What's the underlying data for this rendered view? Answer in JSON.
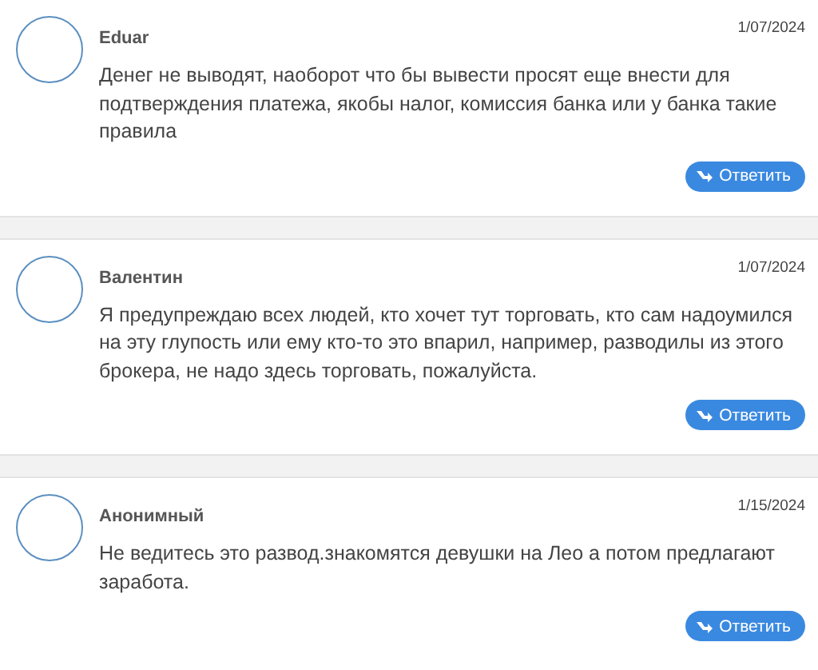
{
  "comments": [
    {
      "author": "Eduar",
      "date": "1/07/2024",
      "text": "Денег не выводят, наоборот что бы вывести просят еще внести для подтверждения платежа, якобы налог, комиссия банка или у банка такие правила",
      "reply": "Ответить"
    },
    {
      "author": "Валентин",
      "date": "1/07/2024",
      "text": "Я предупреждаю всех людей, кто хочет тут торговать, кто сам надоумился на эту глупость или ему кто-то это впарил, например, разводилы из этого брокера, не надо здесь торговать, пожалуйста.",
      "reply": "Ответить"
    },
    {
      "author": "Анонимный",
      "date": "1/15/2024",
      "text": "Не ведитесь это развод.знакомятся девушки на Лео а потом предлагают заработа.",
      "reply": "Ответить"
    }
  ]
}
